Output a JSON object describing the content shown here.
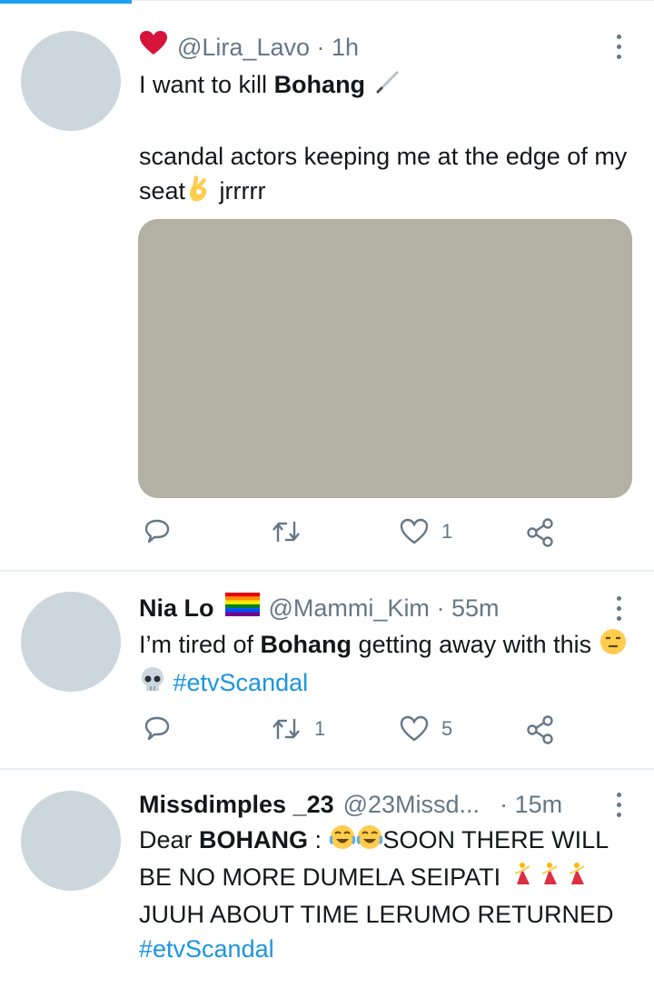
{
  "tweets": [
    {
      "handle": "@Lira_Lavo",
      "time": "1h",
      "line1_text": "I want to kill ",
      "line1_bold": "Bohang",
      "line2": "scandal actors keeping me at the edge of my seat",
      "line2_tail": " jrrrrr",
      "reply_count": "",
      "retweet_count": "",
      "like_count": "1"
    },
    {
      "name": "Nia Lo",
      "handle": "@Mammi_Kim",
      "time": "55m",
      "text_a": "I’m tired of ",
      "text_bold": "Bohang",
      "text_b": " getting away with this ",
      "hashtag": "#etvScandal",
      "retweet_count": "1",
      "like_count": "5"
    },
    {
      "name": "Missdimples _23",
      "handle": "@23Missd...",
      "time": "15m",
      "text_a": "Dear ",
      "text_bold": "BOHANG",
      "text_b": " : ",
      "text_c": "SOON THERE WILL BE NO MORE DUMELA SEIPATI ",
      "text_d": " JUUH ABOUT TIME LERUMO RETURNED ",
      "hashtag": "#etvScandal"
    }
  ],
  "colors": {
    "accent": "#1da1f2",
    "hashtag": "#1b95e0",
    "muted": "#657786",
    "avatar": "#ccd6dd",
    "media": "#b3b0a4"
  },
  "icons": [
    "heart-icon",
    "knife-icon",
    "ok-hand-icon",
    "rainbow-flag-icon",
    "expressionless-face-icon",
    "skull-icon",
    "joy-face-icon",
    "dancer-icon",
    "reply-icon",
    "retweet-icon",
    "like-icon",
    "share-icon",
    "more-icon"
  ]
}
